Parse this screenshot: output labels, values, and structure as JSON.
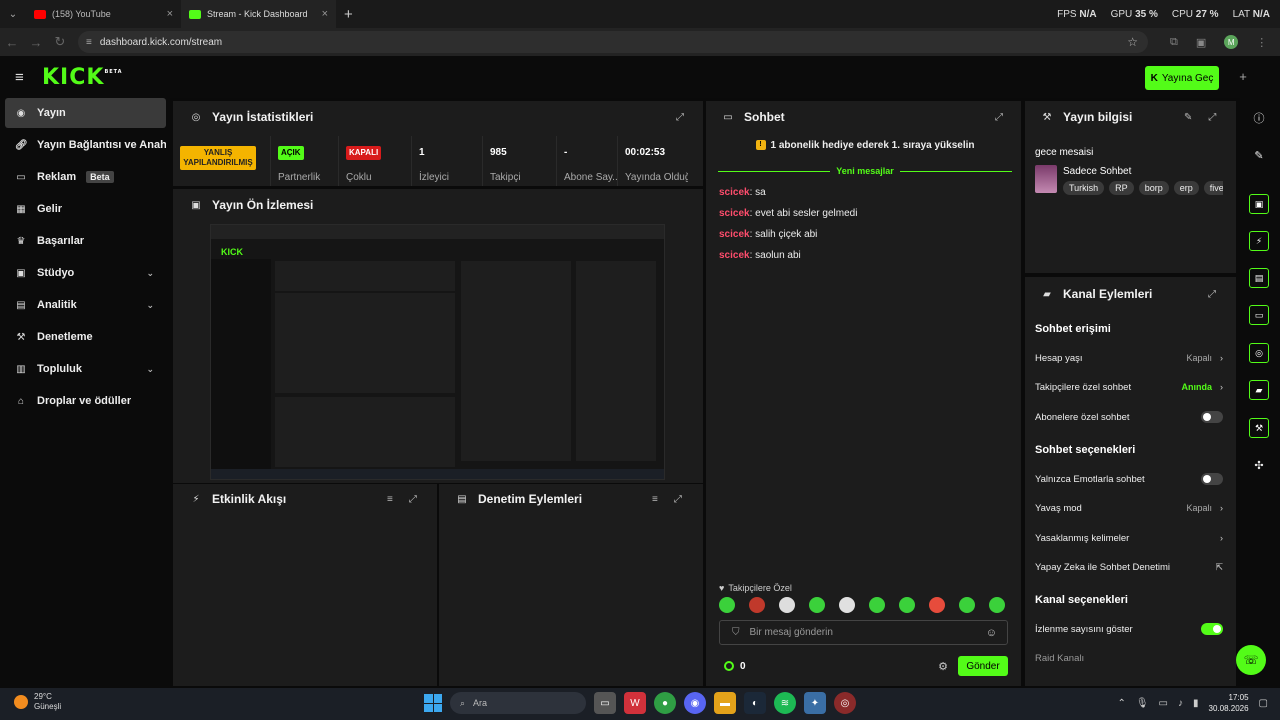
{
  "browser": {
    "tabs": [
      {
        "title": "(158) YouTube",
        "color": "#ff0000"
      },
      {
        "title": "Stream - Kick Dashboard",
        "color": "#53fc18"
      }
    ],
    "perf": {
      "fps_label": "FPS",
      "fps_value": "N/A",
      "gpu_label": "GPU",
      "gpu_value": "35 %",
      "cpu_label": "CPU",
      "cpu_value": "27 %",
      "lat_label": "LAT",
      "lat_value": "N/A"
    },
    "url": "dashboard.kick.com/stream",
    "profile_initial": "M"
  },
  "header": {
    "logo": "KICK",
    "logo_sup": "BETA",
    "go_live": "Yayına Geç"
  },
  "sidebar": {
    "items": [
      {
        "label": "Yayın",
        "icon": "broadcast-icon"
      },
      {
        "label": "Yayın Bağlantısı ve Anahtarı",
        "icon": "link-icon"
      },
      {
        "label": "Reklam",
        "icon": "ad-icon",
        "badge": "Beta"
      },
      {
        "label": "Gelir",
        "icon": "revenue-icon"
      },
      {
        "label": "Başarılar",
        "icon": "trophy-icon"
      },
      {
        "label": "Stüdyo",
        "icon": "studio-icon"
      },
      {
        "label": "Analitik",
        "icon": "analytics-icon"
      },
      {
        "label": "Denetleme",
        "icon": "moderation-icon"
      },
      {
        "label": "Topluluk",
        "icon": "community-icon"
      },
      {
        "label": "Droplar ve ödüller",
        "icon": "gift-icon"
      }
    ]
  },
  "stats": {
    "title": "Yayın İstatistikleri",
    "items": [
      {
        "badge": "YANLIŞ YAPILANDIRILMIŞ",
        "label": "Y..."
      },
      {
        "badge": "AÇIK",
        "label": "Partnerlik"
      },
      {
        "badge": "KAPALI",
        "label": "Çoklu"
      },
      {
        "value": "1",
        "label": "İzleyici"
      },
      {
        "value": "985",
        "label": "Takipçi"
      },
      {
        "value": "-",
        "label": "Abone Say..."
      },
      {
        "value": "00:02:53",
        "label": "Yayında Olduğu..."
      }
    ]
  },
  "preview": {
    "title": "Yayın Ön İzlemesi"
  },
  "activity": {
    "title": "Etkinlik Akışı"
  },
  "moderation": {
    "title": "Denetim Eylemleri"
  },
  "chat": {
    "title": "Sohbet",
    "pinned": "1 abonelik hediye ederek 1. sıraya yükselin",
    "new_messages": "Yeni mesajlar",
    "messages": [
      {
        "user": "scicek",
        "text": "sa"
      },
      {
        "user": "scicek",
        "text": "evet abi sesler gelmedi"
      },
      {
        "user": "scicek",
        "text": "salih çiçek abi"
      },
      {
        "user": "scicek",
        "text": "saolun abi"
      }
    ],
    "followers_label": "Takipçilere Özel",
    "input_placeholder": "Bir mesaj gönderin",
    "points": "0",
    "send": "Gönder"
  },
  "stream_info": {
    "title": "Yayın bilgisi",
    "stream_title": "gece mesaisi",
    "category": "Sadece Sohbet",
    "tags": [
      "Turkish",
      "RP",
      "borp",
      "erp",
      "fivem"
    ]
  },
  "channel_actions": {
    "title": "Kanal Eylemleri",
    "sections": [
      {
        "heading": "Sohbet erişimi",
        "rows": [
          {
            "label": "Hesap yaşı",
            "value": "Kapalı",
            "kind": "chevron"
          },
          {
            "label": "Takipçilere özel sohbet",
            "value": "Anında",
            "kind": "chevron",
            "accent": true
          },
          {
            "label": "Abonelere özel sohbet",
            "kind": "toggle",
            "on": false
          }
        ]
      },
      {
        "heading": "Sohbet seçenekleri",
        "rows": [
          {
            "label": "Yalnızca Emotlarla sohbet",
            "kind": "toggle",
            "on": false
          },
          {
            "label": "Yavaş mod",
            "value": "Kapalı",
            "kind": "chevron"
          },
          {
            "label": "Yasaklanmış kelimeler",
            "kind": "chevron"
          },
          {
            "label": "Yapay Zeka ile Sohbet Denetimi",
            "kind": "external"
          }
        ]
      },
      {
        "heading": "Kanal seçenekleri",
        "rows": [
          {
            "label": "İzlenme sayısını göster",
            "kind": "toggle",
            "on": true
          },
          {
            "label": "Raid Kanalı",
            "kind": "text"
          }
        ]
      }
    ]
  },
  "taskbar": {
    "temp": "29°C",
    "weather": "Güneşli",
    "search": "Ara",
    "time": "17:05",
    "date": "30.08.2026"
  }
}
